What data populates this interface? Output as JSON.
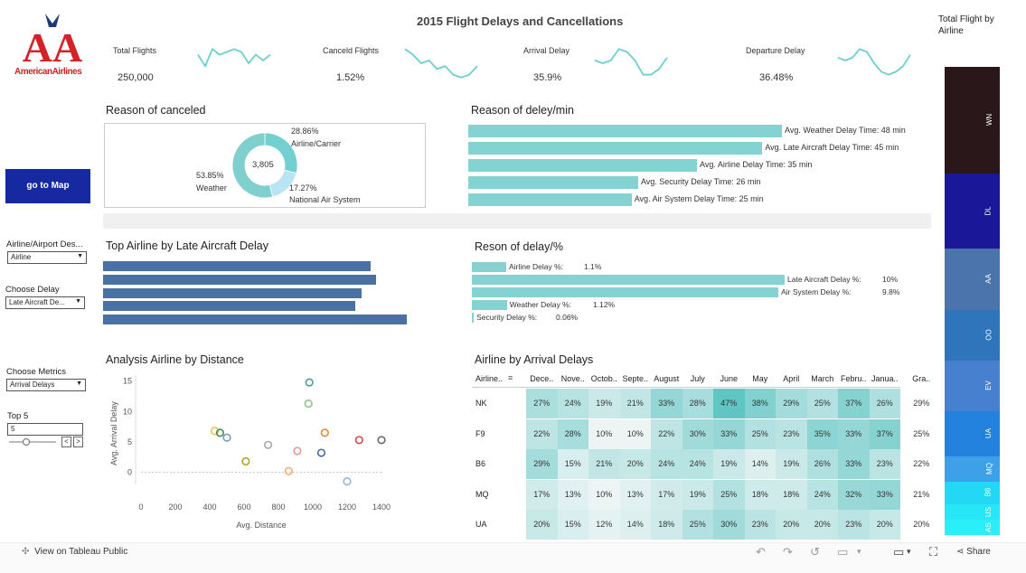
{
  "dashboard": {
    "title": "2015 Flight Delays and Cancellations"
  },
  "logo": {
    "letters": "AA",
    "text": "AmericanAirlines"
  },
  "kpis": [
    {
      "label": "Total Flights",
      "value": "250,000",
      "spark": [
        5,
        3,
        6,
        5,
        5.5,
        6,
        5.5,
        3.5,
        5,
        4,
        5
      ]
    },
    {
      "label": "Canceld Flights",
      "value": "1.52%",
      "spark": [
        6,
        5,
        3.5,
        4,
        2.5,
        3,
        1.5,
        1,
        1.5,
        3
      ]
    },
    {
      "label": "Arrival Delay",
      "value": "35.9%",
      "spark": [
        4,
        3.5,
        4,
        6,
        5.5,
        4,
        1.5,
        1.5,
        2.5,
        4.5
      ]
    },
    {
      "label": "Departure Delay",
      "value": "36.48%",
      "spark": [
        4.5,
        4,
        4.5,
        6,
        5.5,
        3.5,
        2,
        1.5,
        2,
        3,
        5
      ]
    }
  ],
  "right_panel": {
    "title": "Total Flight by Airline",
    "airlines": [
      {
        "code": "WN",
        "share": 0.215,
        "color": "#2a1719"
      },
      {
        "code": "DL",
        "share": 0.149,
        "color": "#1a1898"
      },
      {
        "code": "AA",
        "share": 0.125,
        "color": "#4b74ad"
      },
      {
        "code": "OO",
        "share": 0.101,
        "color": "#2f75bb"
      },
      {
        "code": "EV",
        "share": 0.101,
        "color": "#4680cf"
      },
      {
        "code": "UA",
        "share": 0.092,
        "color": "#2382de"
      },
      {
        "code": "MQ",
        "share": 0.05,
        "color": "#3ea0e8"
      },
      {
        "code": "B6",
        "share": 0.045,
        "color": "#22d8f4"
      },
      {
        "code": "US",
        "share": 0.032,
        "color": "#26e6f7"
      },
      {
        "code": "AS",
        "share": 0.03,
        "color": "#2aeef8"
      }
    ]
  },
  "controls": {
    "goto_map": "go to Map",
    "airline_airport": {
      "label": "Airline/Airport Des...",
      "value": "Airline"
    },
    "choose_delay": {
      "label": "Choose Delay",
      "value": "Late Aircraft De..."
    },
    "choose_metrics": {
      "label": "Choose Metrics",
      "value": "Arrival Delays"
    },
    "top5": {
      "label": "Top 5",
      "value": "5",
      "prev": "<",
      "next": ">"
    }
  },
  "reason_canceled": {
    "title": "Reason of canceled",
    "center_value": "3,805",
    "slices": [
      {
        "pct": "28.86%",
        "name": "Airline/Carrier",
        "value": 28.86,
        "color": "#72d1d0"
      },
      {
        "pct": "17.27%",
        "name": "National Air System",
        "value": 17.27,
        "color": "#b9e4f2"
      },
      {
        "pct": "53.85%",
        "name": "Weather",
        "value": 53.85,
        "color": "#7fcfcf"
      }
    ]
  },
  "reason_delay_min": {
    "title": "Reason of deley/min",
    "bars": [
      {
        "label": "Avg. Weather Delay Time: 48  min",
        "value": 48
      },
      {
        "label": "Avg. Late Aircraft Delay Time: 45  min",
        "value": 45
      },
      {
        "label": "Avg. Airline Delay Time: 35  min",
        "value": 35
      },
      {
        "label": "Avg. Security Delay Time: 26  min",
        "value": 26
      },
      {
        "label": "Avg. Air System Delay Time: 25  min",
        "value": 25
      }
    ]
  },
  "top_airline_late": {
    "title": "Top Airline by Late Aircraft Delay",
    "bars": [
      0.88,
      0.9,
      0.85,
      0.83,
      1.0
    ]
  },
  "reason_delay_pct": {
    "title": "Reson of delay/%",
    "bars": [
      {
        "name": "Airline Delay %:",
        "pct": "1.1%",
        "value": 1.1
      },
      {
        "name": "Late Aircraft Delay %:",
        "pct": "10%",
        "value": 10
      },
      {
        "name": "Air System Delay %:",
        "pct": "9.8%",
        "value": 9.8
      },
      {
        "name": "Weather Delay %:",
        "pct": "1.12%",
        "value": 1.12
      },
      {
        "name": "Security Delay %:",
        "pct": "0.06%",
        "value": 0.06
      }
    ]
  },
  "scatter": {
    "title": "Analysis Airline by Distance",
    "xlabel": "Avg. Distance",
    "ylabel": "Avg. Arrival Delay",
    "xticks": [
      "0",
      "200",
      "400",
      "600",
      "800",
      "1000",
      "1200",
      "1400"
    ],
    "yticks": [
      "0",
      "5",
      "10",
      "15"
    ],
    "points": [
      {
        "x": 980,
        "y": 14.8,
        "color": "#4a9c9c"
      },
      {
        "x": 975,
        "y": 11.3,
        "color": "#8fc58a"
      },
      {
        "x": 430,
        "y": 6.8,
        "color": "#e8c44a"
      },
      {
        "x": 460,
        "y": 6.5,
        "color": "#3f8f5c"
      },
      {
        "x": 500,
        "y": 5.7,
        "color": "#7a9cba"
      },
      {
        "x": 1070,
        "y": 6.5,
        "color": "#e08a3a"
      },
      {
        "x": 740,
        "y": 4.5,
        "color": "#a8a8a8"
      },
      {
        "x": 1270,
        "y": 5.3,
        "color": "#d04a4a"
      },
      {
        "x": 1400,
        "y": 5.3,
        "color": "#666"
      },
      {
        "x": 910,
        "y": 3.5,
        "color": "#e89a9a"
      },
      {
        "x": 1050,
        "y": 3.2,
        "color": "#4a6aa8"
      },
      {
        "x": 610,
        "y": 1.8,
        "color": "#b8a030"
      },
      {
        "x": 860,
        "y": 0.2,
        "color": "#f0b070"
      },
      {
        "x": 1200,
        "y": -1.5,
        "color": "#8fb8d8"
      }
    ]
  },
  "heatmap": {
    "title": "Airline by Arrival Delays",
    "corner": "Airline..",
    "columns": [
      "Dece..",
      "Nove..",
      "Octob..",
      "Septe..",
      "August",
      "July",
      "June",
      "May",
      "April",
      "March",
      "Febru..",
      "Janua..",
      "Gra.."
    ],
    "rows": [
      {
        "name": "NK",
        "values": [
          "27%",
          "24%",
          "19%",
          "21%",
          "33%",
          "28%",
          "47%",
          "38%",
          "29%",
          "25%",
          "37%",
          "26%",
          "29%"
        ]
      },
      {
        "name": "F9",
        "values": [
          "22%",
          "28%",
          "10%",
          "10%",
          "22%",
          "30%",
          "33%",
          "25%",
          "23%",
          "35%",
          "33%",
          "37%",
          "25%"
        ]
      },
      {
        "name": "B6",
        "values": [
          "29%",
          "15%",
          "21%",
          "20%",
          "24%",
          "24%",
          "19%",
          "14%",
          "19%",
          "26%",
          "33%",
          "23%",
          "22%"
        ]
      },
      {
        "name": "MQ",
        "values": [
          "17%",
          "13%",
          "10%",
          "13%",
          "17%",
          "19%",
          "25%",
          "18%",
          "18%",
          "24%",
          "32%",
          "33%",
          "21%"
        ]
      },
      {
        "name": "UA",
        "values": [
          "20%",
          "15%",
          "12%",
          "14%",
          "18%",
          "25%",
          "30%",
          "23%",
          "20%",
          "20%",
          "23%",
          "20%",
          "20%"
        ]
      }
    ]
  },
  "footer": {
    "view_on": "View on Tableau Public",
    "share": "Share"
  }
}
